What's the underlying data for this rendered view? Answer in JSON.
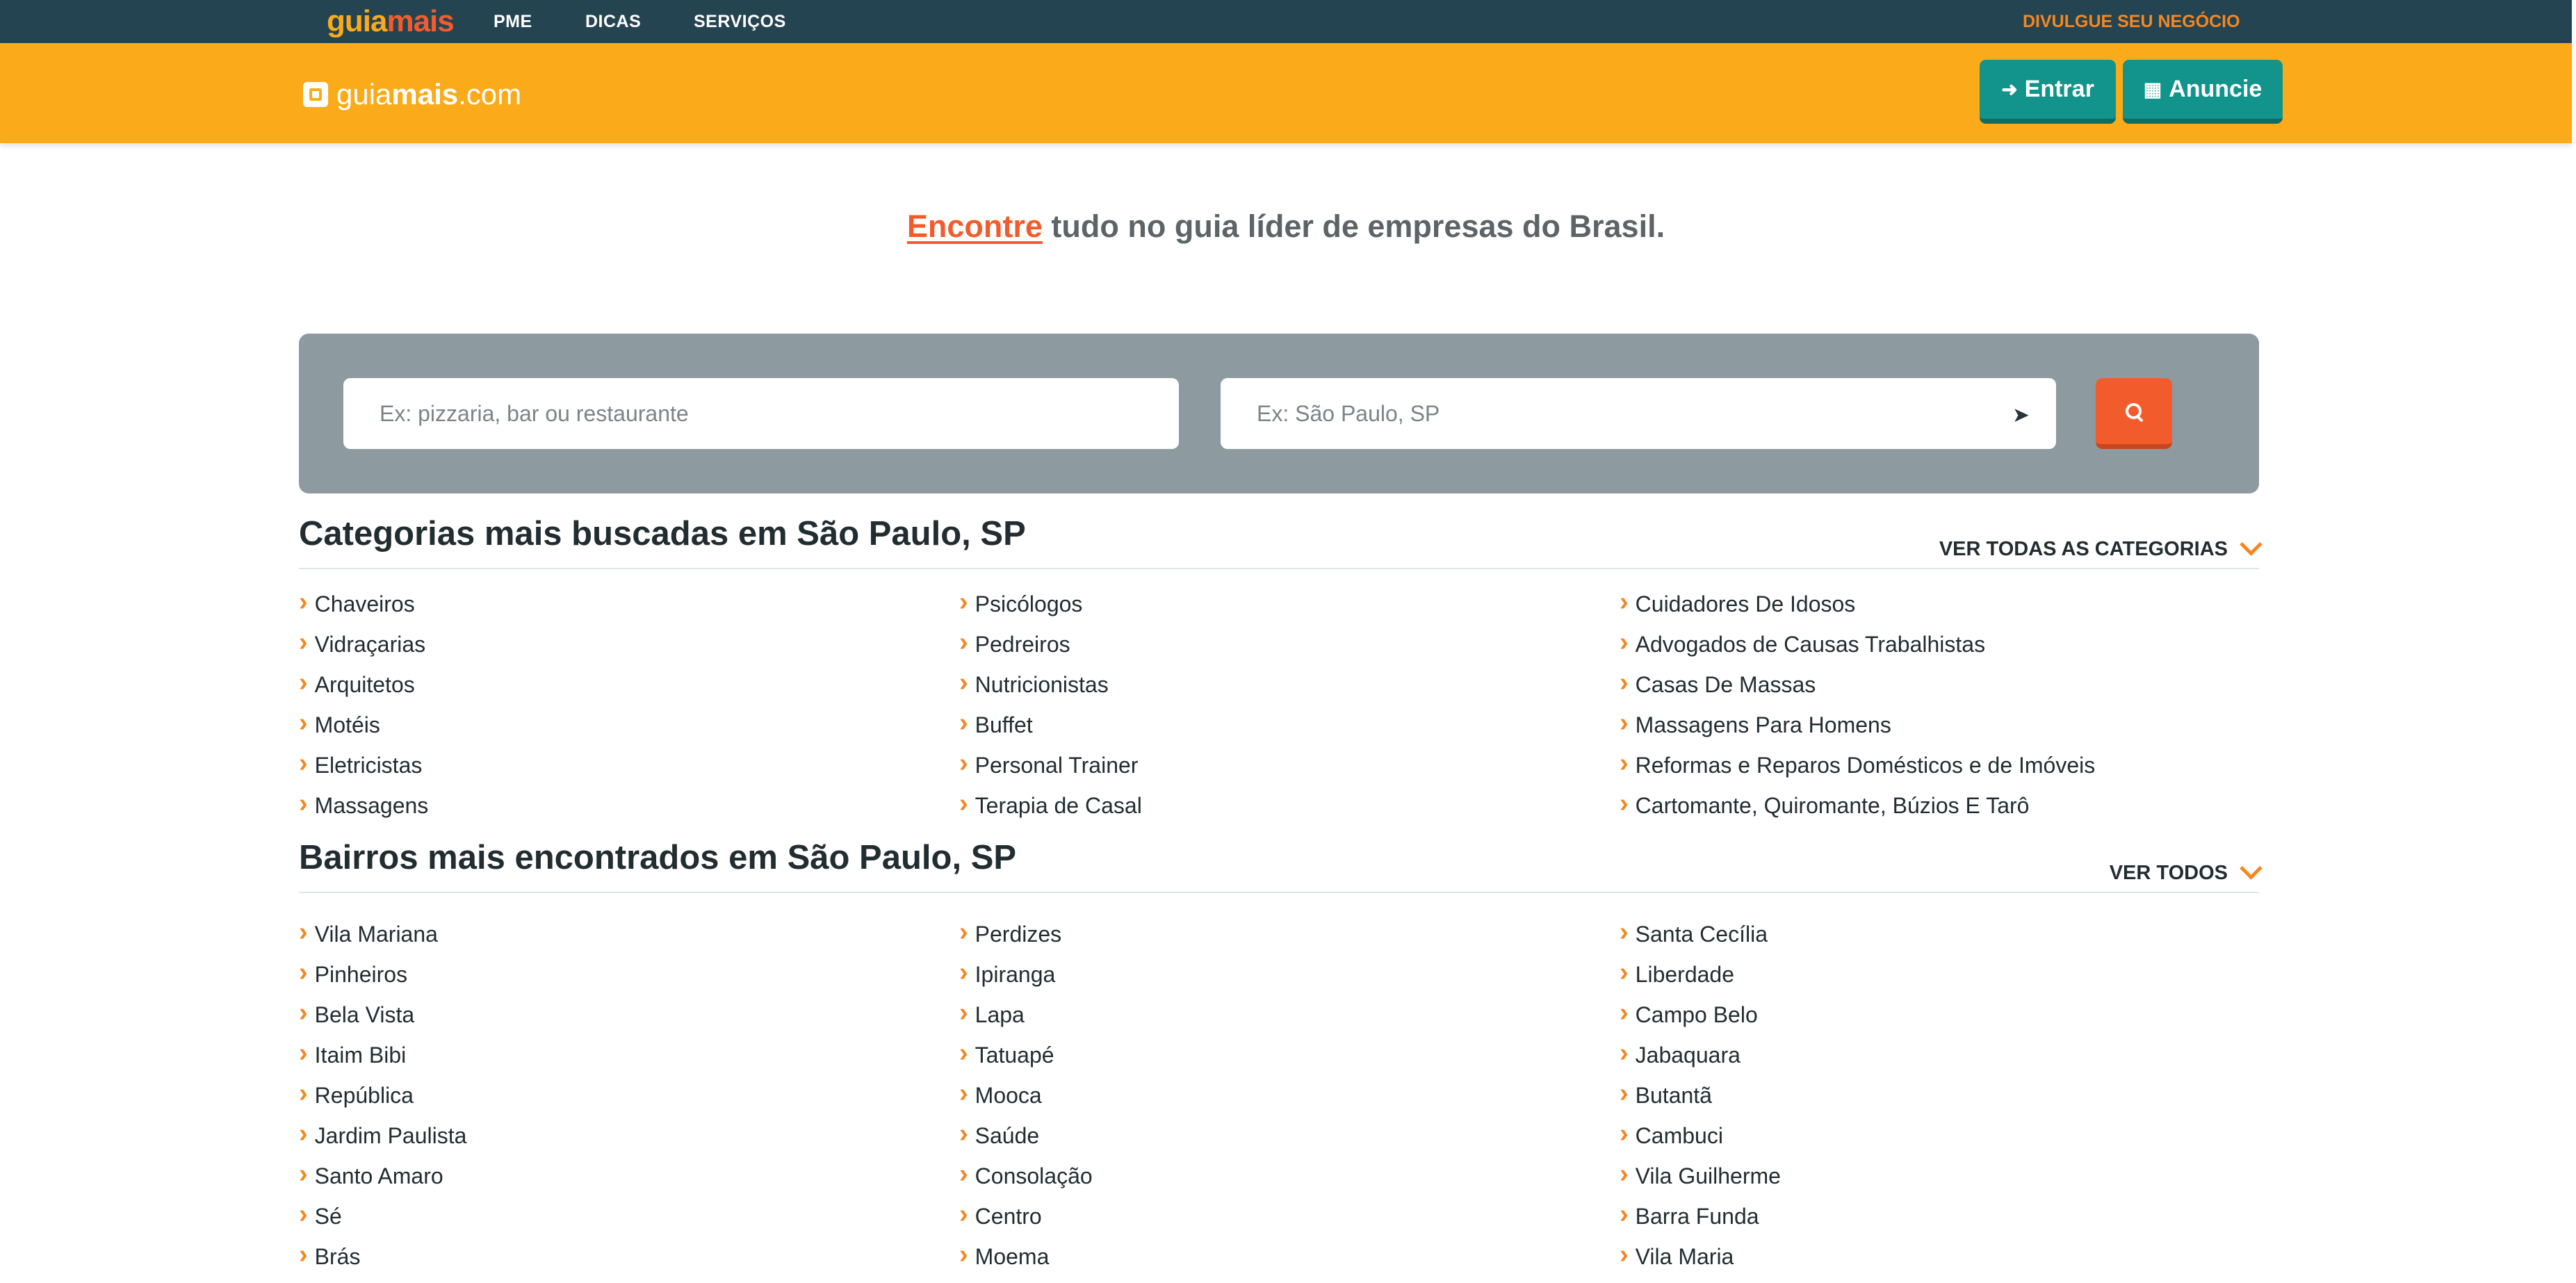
{
  "topbar": {
    "brand_a": "guia",
    "brand_b": "mais",
    "nav": [
      "PME",
      "DICAS",
      "SERVIÇOS"
    ],
    "divulgue": "DIVULGUE SEU NEGÓCIO"
  },
  "header": {
    "logo_a": "guia",
    "logo_b": "mais",
    "logo_c": ".com",
    "login_label": "Entrar",
    "advertise_label": "Anuncie"
  },
  "tagline": {
    "highlight": "Encontre",
    "rest": " tudo no guia líder de empresas do Brasil."
  },
  "search": {
    "what_placeholder": "Ex: pizzaria, bar ou restaurante",
    "where_placeholder": "Ex: São Paulo, SP"
  },
  "categories": {
    "title": "Categorias mais buscadas em São Paulo, SP",
    "see_all": "VER TODAS AS CATEGORIAS",
    "col1": [
      "Chaveiros",
      "Vidraçarias",
      "Arquitetos",
      "Motéis",
      "Eletricistas",
      "Massagens"
    ],
    "col2": [
      "Psicólogos",
      "Pedreiros",
      "Nutricionistas",
      "Buffet",
      "Personal Trainer",
      "Terapia de Casal"
    ],
    "col3": [
      "Cuidadores De Idosos",
      "Advogados de Causas Trabalhistas",
      "Casas De Massas",
      "Massagens Para Homens",
      "Reformas e Reparos Domésticos e de Imóveis",
      "Cartomante, Quiromante, Búzios E Tarô"
    ]
  },
  "neighborhoods": {
    "title": "Bairros mais encontrados em São Paulo, SP",
    "see_all": "VER TODOS",
    "col1": [
      "Vila Mariana",
      "Pinheiros",
      "Bela Vista",
      "Itaim Bibi",
      "República",
      "Jardim Paulista",
      "Santo Amaro",
      "Sé",
      "Brás"
    ],
    "col2": [
      "Perdizes",
      "Ipiranga",
      "Lapa",
      "Tatuapé",
      "Mooca",
      "Saúde",
      "Consolação",
      "Centro",
      "Moema"
    ],
    "col3": [
      "Santa Cecília",
      "Liberdade",
      "Campo Belo",
      "Jabaquara",
      "Butantã",
      "Cambuci",
      "Vila Guilherme",
      "Barra Funda",
      "Vila Maria"
    ]
  }
}
